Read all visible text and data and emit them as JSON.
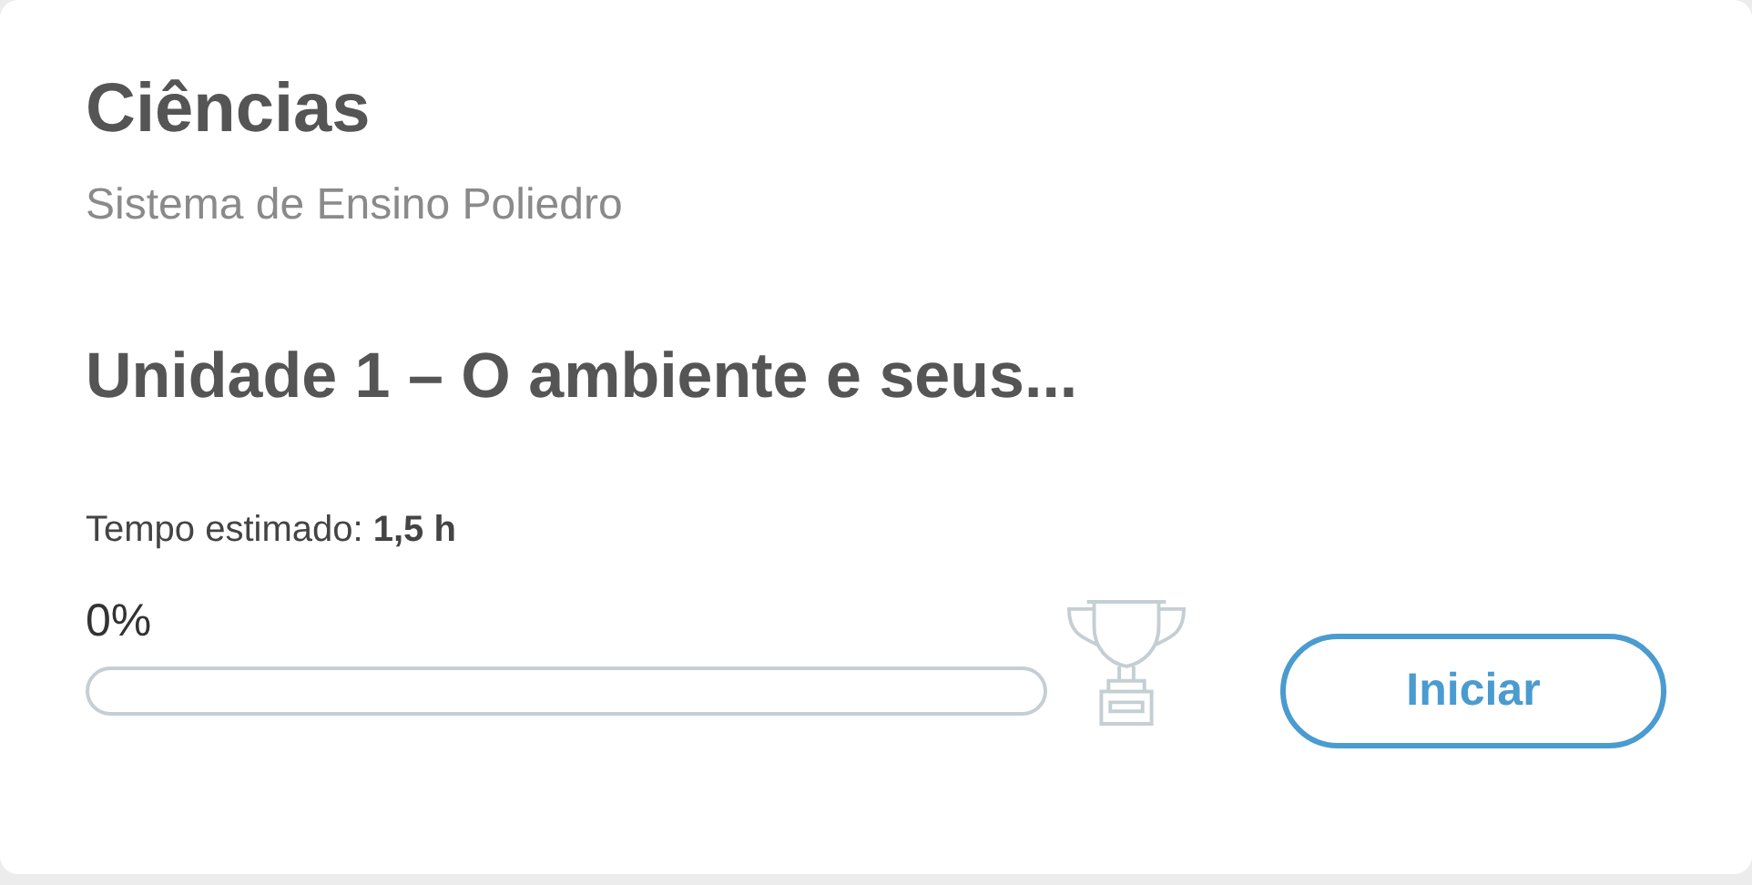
{
  "card": {
    "title": "Ciências",
    "subtitle": "Sistema de Ensino Poliedro",
    "unit_title": "Unidade 1 – O ambiente e seus...",
    "estimate": "Tempo estimado: **1,5 h**",
    "progress": {
      "reading": "0%",
      "level": 0
    },
    "button": "Iniciar"
  }
}
